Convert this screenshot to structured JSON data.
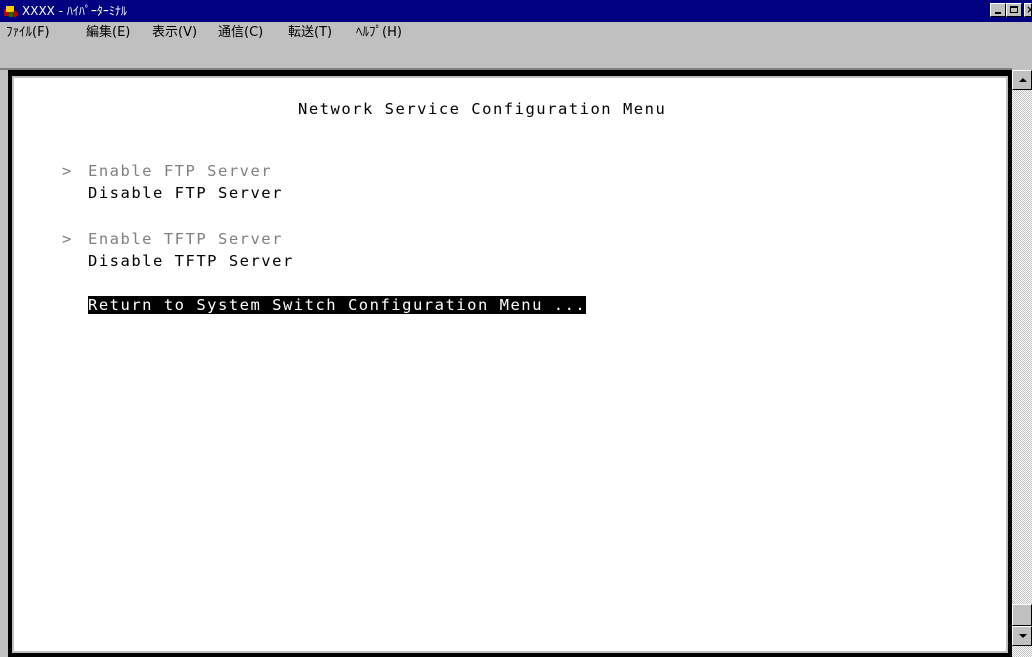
{
  "window": {
    "title": "XXXX - ﾊｲﾊﾟｰﾀｰﾐﾅﾙ",
    "controls": {
      "minimize": "_",
      "maximize": "□",
      "close": "×"
    }
  },
  "menu": {
    "items": [
      {
        "label": "ﾌｧｲﾙ(F)"
      },
      {
        "label": "編集(E)"
      },
      {
        "label": "表示(V)"
      },
      {
        "label": "通信(C)"
      },
      {
        "label": "転送(T)"
      },
      {
        "label": "ﾍﾙﾌﾟ(H)"
      }
    ]
  },
  "terminal": {
    "title": "Network Service Configuration Menu",
    "groups": [
      {
        "marker": ">",
        "enable": "Enable FTP Server",
        "disable": "Disable FTP Server"
      },
      {
        "marker": ">",
        "enable": "Enable TFTP Server",
        "disable": "Disable TFTP Server"
      }
    ],
    "return_item": "Return to System Switch Configuration Menu ..."
  },
  "colors": {
    "titlebar": "#000080",
    "face": "#c0c0c0",
    "terminal_bg": "#ffffff",
    "dim_text": "#808080",
    "highlight_bg": "#000000",
    "highlight_fg": "#ffffff"
  }
}
